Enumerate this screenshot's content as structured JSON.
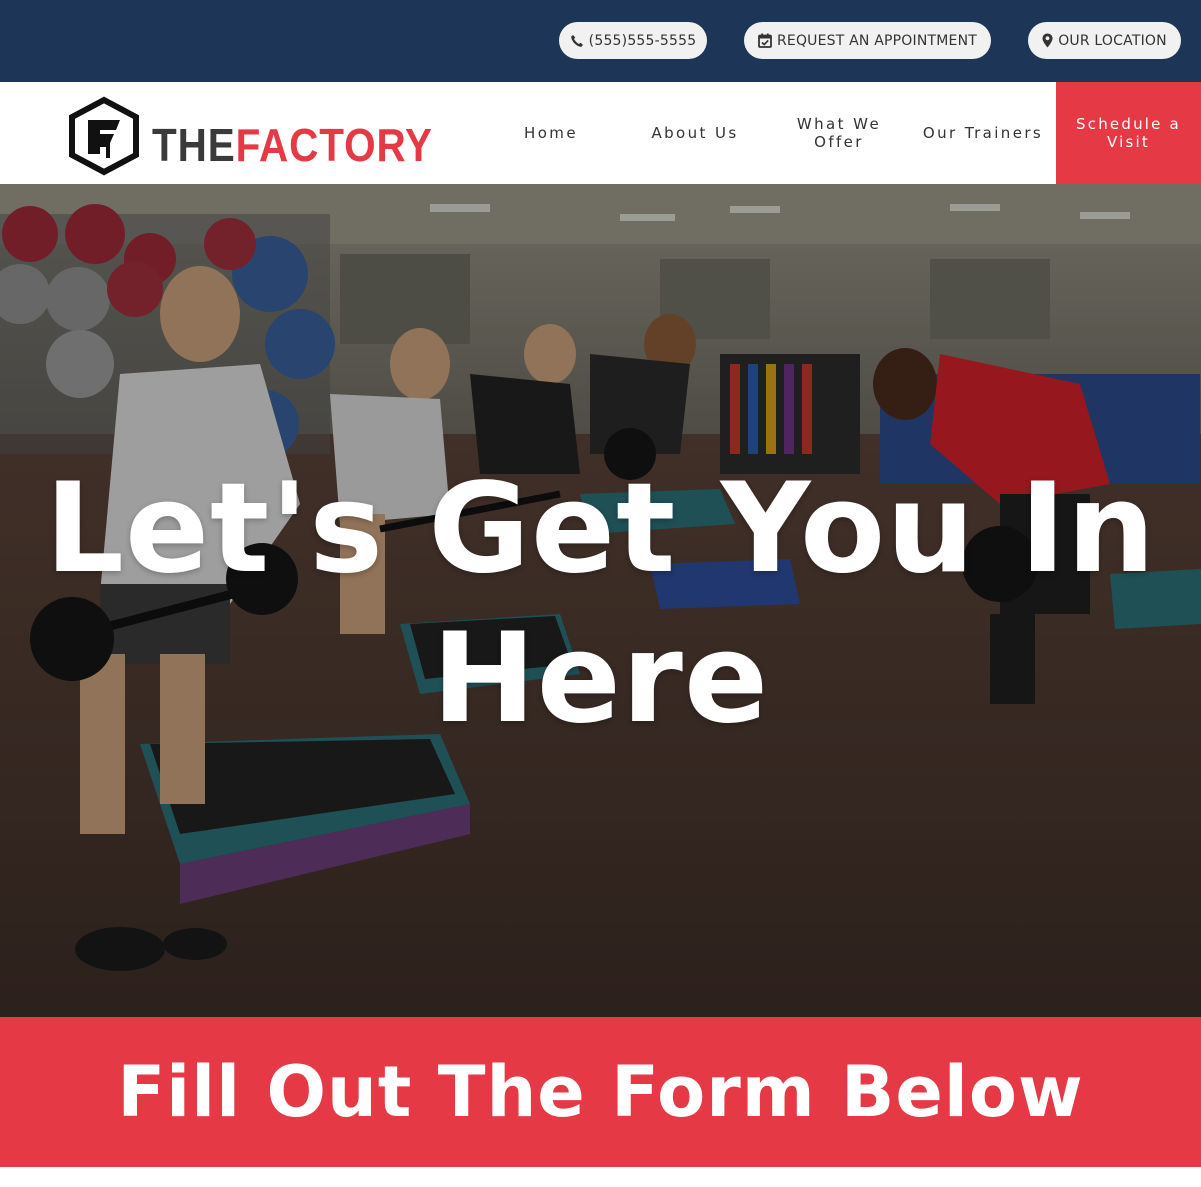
{
  "topbar": {
    "phone": "(555)555-5555",
    "appointment": "REQUEST AN APPOINTMENT",
    "location": "OUR LOCATION"
  },
  "header": {
    "logo_the": "THE",
    "logo_factory": "FACTORY",
    "nav": [
      "Home",
      "About Us",
      "What We Offer",
      "Our Trainers"
    ],
    "cta": "Schedule a Visit"
  },
  "hero": {
    "title_line1": "Let's Get You In",
    "title_line2": "Here"
  },
  "form_banner": {
    "title": "Fill Out The Form Below"
  },
  "colors": {
    "navy": "#1d3557",
    "accent_red": "#e63946",
    "pill_bg": "#f1f1f1"
  },
  "icons": [
    "phone-icon",
    "calendar-check-icon",
    "map-marker-icon",
    "factory-logo-icon"
  ]
}
